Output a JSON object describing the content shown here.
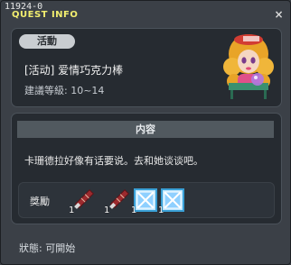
{
  "window": {
    "id": "11924-0",
    "title": "QUEST INFO",
    "close": "×"
  },
  "quest": {
    "tag": "活動",
    "name": "[活动] 爱情巧克力棒",
    "level_label": "建議等級",
    "level_range": "10~14"
  },
  "content": {
    "header": "内容",
    "description": "卡珊德拉好像有话要说。去和她谈谈吧。"
  },
  "rewards": {
    "label": "獎勵",
    "items": [
      {
        "name": "chocolate-stick-icon",
        "qty": "1",
        "color": "#9c2a2e"
      },
      {
        "name": "chocolate-stick-icon",
        "qty": "1",
        "color": "#9c2a2e"
      },
      {
        "name": "blue-frame-icon",
        "qty": "1",
        "color": "#3aa0d6"
      },
      {
        "name": "blue-frame-icon",
        "qty": "1",
        "color": "#3aa0d6"
      }
    ]
  },
  "status": "狀態: 可開始"
}
